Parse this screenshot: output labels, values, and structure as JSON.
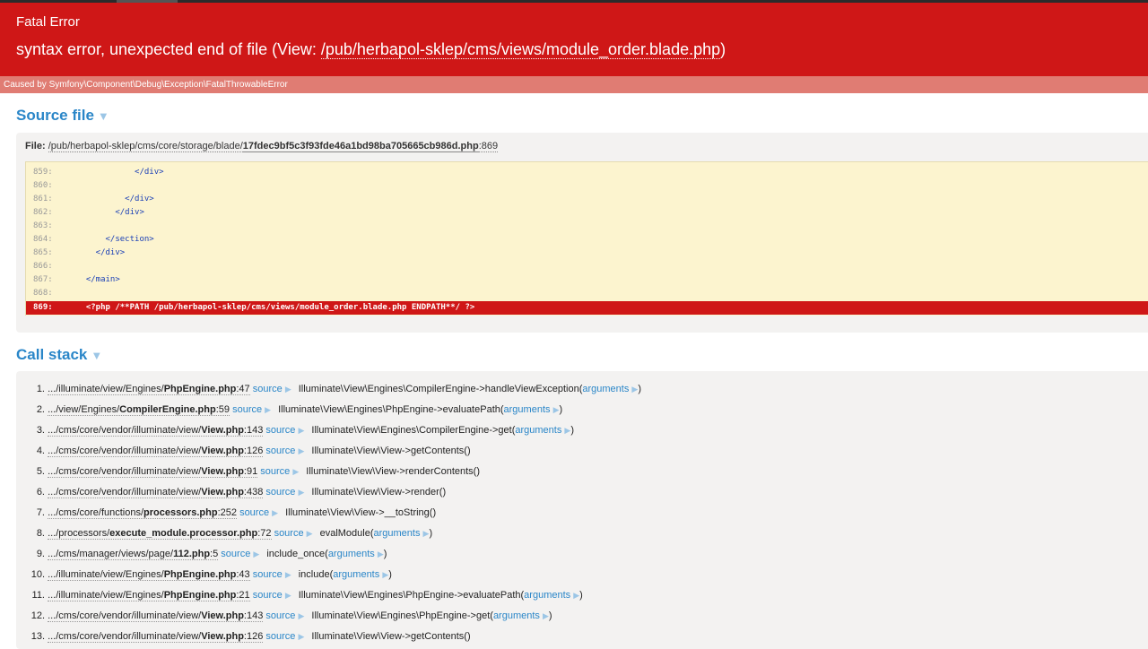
{
  "error": {
    "type": "Fatal Error",
    "message_prefix": "syntax error, unexpected end of file (View: ",
    "message_path": "/pub/herbapol-sklep/cms/views/module_order.blade.php",
    "message_suffix": ")",
    "caused_by": "Caused by Symfony\\Component\\Debug\\Exception\\FatalThrowableError"
  },
  "source": {
    "title": "Source file",
    "file_label": "File:",
    "file_path": "/pub/herbapol-sklep/cms/core/storage/blade/",
    "file_name": "17fdec9bf5c3f93fde46a1bd98ba705665cb986d.php",
    "file_line": ":869",
    "lines": [
      {
        "num": "859:",
        "code": "            </div>"
      },
      {
        "num": "860:",
        "code": ""
      },
      {
        "num": "861:",
        "code": "          </div>"
      },
      {
        "num": "862:",
        "code": "        </div>"
      },
      {
        "num": "863:",
        "code": ""
      },
      {
        "num": "864:",
        "code": "      </section>"
      },
      {
        "num": "865:",
        "code": "    </div>"
      },
      {
        "num": "866:",
        "code": ""
      },
      {
        "num": "867:",
        "code": "  </main>"
      },
      {
        "num": "868:",
        "code": ""
      },
      {
        "num": "869:",
        "code": "  <?php /**PATH /pub/herbapol-sklep/cms/views/module_order.blade.php ENDPATH**/ ?>"
      }
    ]
  },
  "callstack": {
    "title": "Call stack",
    "source_label": "source",
    "arguments_label": "arguments",
    "items": [
      {
        "idx": "1.",
        "dir": ".../illuminate/view/Engines/",
        "file": "PhpEngine.php",
        "line": ":47",
        "call": "Illuminate\\View\\Engines\\CompilerEngine->handleViewException(",
        "args": true
      },
      {
        "idx": "2.",
        "dir": ".../view/Engines/",
        "file": "CompilerEngine.php",
        "line": ":59",
        "call": "Illuminate\\View\\Engines\\PhpEngine->evaluatePath(",
        "args": true
      },
      {
        "idx": "3.",
        "dir": ".../cms/core/vendor/illuminate/view/",
        "file": "View.php",
        "line": ":143",
        "call": "Illuminate\\View\\Engines\\CompilerEngine->get(",
        "args": true
      },
      {
        "idx": "4.",
        "dir": ".../cms/core/vendor/illuminate/view/",
        "file": "View.php",
        "line": ":126",
        "call": "Illuminate\\View\\View->getContents()",
        "args": false
      },
      {
        "idx": "5.",
        "dir": ".../cms/core/vendor/illuminate/view/",
        "file": "View.php",
        "line": ":91",
        "call": "Illuminate\\View\\View->renderContents()",
        "args": false
      },
      {
        "idx": "6.",
        "dir": ".../cms/core/vendor/illuminate/view/",
        "file": "View.php",
        "line": ":438",
        "call": "Illuminate\\View\\View->render()",
        "args": false
      },
      {
        "idx": "7.",
        "dir": ".../cms/core/functions/",
        "file": "processors.php",
        "line": ":252",
        "call": "Illuminate\\View\\View->__toString()",
        "args": false
      },
      {
        "idx": "8.",
        "dir": ".../processors/",
        "file": "execute_module.processor.php",
        "line": ":72",
        "call": "evalModule(",
        "args": true
      },
      {
        "idx": "9.",
        "dir": ".../cms/manager/views/page/",
        "file": "112.php",
        "line": ":5",
        "call": "include_once(",
        "args": true
      },
      {
        "idx": "10.",
        "dir": ".../illuminate/view/Engines/",
        "file": "PhpEngine.php",
        "line": ":43",
        "call": "include(",
        "args": true
      },
      {
        "idx": "11.",
        "dir": ".../illuminate/view/Engines/",
        "file": "PhpEngine.php",
        "line": ":21",
        "call": "Illuminate\\View\\Engines\\PhpEngine->evaluatePath(",
        "args": true
      },
      {
        "idx": "12.",
        "dir": ".../cms/core/vendor/illuminate/view/",
        "file": "View.php",
        "line": ":143",
        "call": "Illuminate\\View\\Engines\\PhpEngine->get(",
        "args": true
      },
      {
        "idx": "13.",
        "dir": ".../cms/core/vendor/illuminate/view/",
        "file": "View.php",
        "line": ":126",
        "call": "Illuminate\\View\\View->getContents()",
        "args": false
      }
    ]
  },
  "colors": {
    "header_red": "#cf1717",
    "caused_by_bg": "#e07c73",
    "link_blue": "#2a86c8",
    "code_bg": "#fcf4cf"
  },
  "icons": {
    "section_toggle": "triangle-down-icon",
    "expand": "triangle-right-icon"
  }
}
